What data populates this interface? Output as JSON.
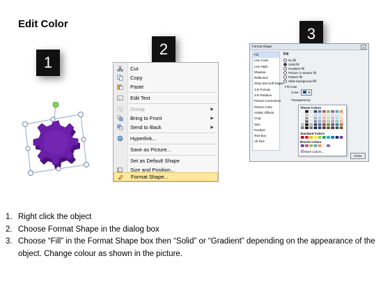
{
  "title": "Edit Color",
  "steps_markers": [
    "1",
    "2",
    "3"
  ],
  "context_menu": {
    "items": [
      {
        "label": "Cut",
        "icon": "scissors-icon",
        "disabled": false
      },
      {
        "label": "Copy",
        "icon": "copy-icon",
        "disabled": false
      },
      {
        "label": "Paste",
        "icon": "paste-icon",
        "disabled": false
      },
      {
        "label": "Edit Text",
        "icon": "edit-text-icon",
        "disabled": false
      },
      {
        "label": "Group",
        "icon": "group-icon",
        "disabled": true
      },
      {
        "label": "Bring to Front",
        "icon": "bring-front-icon",
        "disabled": false
      },
      {
        "label": "Send to Back",
        "icon": "send-back-icon",
        "disabled": false
      },
      {
        "label": "Hyperlink...",
        "icon": "hyperlink-icon",
        "disabled": false
      },
      {
        "label": "Save as Picture...",
        "icon": "",
        "disabled": false
      },
      {
        "label": "Set as Default Shape",
        "icon": "",
        "disabled": false
      },
      {
        "label": "Size and Position...",
        "icon": "size-position-icon",
        "disabled": false
      },
      {
        "label": "Format Shape...",
        "icon": "format-shape-icon",
        "disabled": false,
        "highlighted": true
      }
    ]
  },
  "dialog": {
    "title": "Format Shape",
    "close_x": "x",
    "sidebar": [
      "Fill",
      "Line Color",
      "Line Style",
      "Shadow",
      "Reflection",
      "Glow and Soft Edges",
      "3-D Format",
      "3-D Rotation",
      "Picture Corrections",
      "Picture Color",
      "Artistic Effects",
      "Crop",
      "Size",
      "Position",
      "Text Box",
      "Alt Text"
    ],
    "fill_header": "Fill",
    "options": [
      "No fill",
      "Solid fill",
      "Gradient fill",
      "Picture or texture fill",
      "Pattern fill",
      "Slide background fill"
    ],
    "fill_color_label": "Fill Color",
    "color_label": "Color:",
    "transparency_label": "Transparency:",
    "theme_colors_label": "Theme Colors",
    "standard_colors_label": "Standard Colors",
    "recent_colors_label": "Recent Colors",
    "more_colors_label": "More Colors...",
    "close_button": "Close",
    "theme_top": [
      "#ffffff",
      "#000000",
      "#eeece1",
      "#1f497d",
      "#4f81bd",
      "#c0504d",
      "#9bbb59",
      "#8064a2",
      "#4bacc6",
      "#f79646"
    ],
    "standard": [
      "#c00000",
      "#ff0000",
      "#ffc000",
      "#ffff00",
      "#92d050",
      "#00b050",
      "#00b0f0",
      "#0070c0",
      "#002060",
      "#7030a0"
    ],
    "recent": [
      "#7030a0",
      "#c0504d",
      "#9bbb59",
      "#4bacc6",
      "#f79646",
      "#ffffff",
      "#8064a2"
    ]
  },
  "gear_color": "#6b1fa8",
  "instructions": [
    {
      "num": "1.",
      "text": "Right click the object"
    },
    {
      "num": "2.",
      "text": "Choose Format Shape in the dialog box"
    },
    {
      "num": "3.",
      "text": "Choose “Fill” in the Format Shape box then “Solid” or “Gradient” depending on the appearance of the object. Change colour as shown in the picture."
    }
  ]
}
